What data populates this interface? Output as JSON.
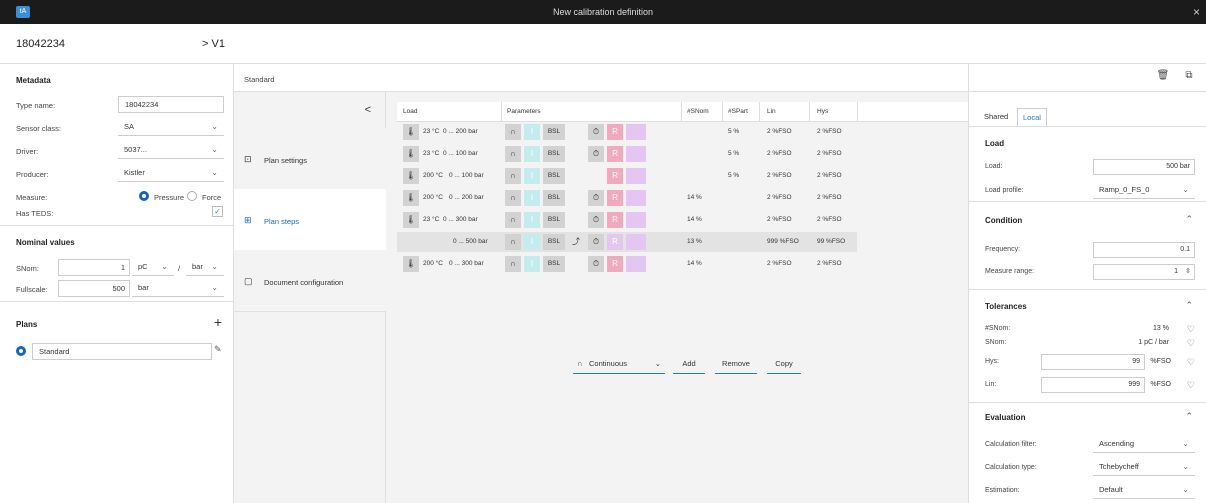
{
  "window": {
    "title": "New calibration definition",
    "close": "×",
    "logo": "tA"
  },
  "header": {
    "serial": "18042234",
    "version": "> V1"
  },
  "metadata": {
    "title": "Metadata",
    "type_label": "Type name:",
    "type_value": "18042234",
    "class_label": "Sensor class:",
    "class_value": "SA",
    "driver_label": "Driver:",
    "driver_value": "5037...",
    "producer_label": "Producer:",
    "producer_value": "Kistler",
    "measure_label": "Measure:",
    "measure_opt1": "Pressure",
    "measure_opt2": "Force",
    "teds_label": "Has TEDS:"
  },
  "nominal": {
    "title": "Nominal values",
    "snom_label": "SNom:",
    "snom_value": "1",
    "unit1": "pC",
    "slash": "/",
    "unit2": "bar",
    "fs_label": "Fullscale:",
    "fs_value": "500",
    "fs_unit": "bar"
  },
  "plans": {
    "title": "Plans",
    "add": "+",
    "item": "Standard"
  },
  "middle": {
    "title": "Standard",
    "collapse": "<"
  },
  "nav": {
    "settings": "Plan settings",
    "steps": "Plan steps",
    "docs": "Document configuration"
  },
  "grid": {
    "headers": {
      "load": "Load",
      "params": "Parameters",
      "snom": "#SNom",
      "spart": "#SPart",
      "lin": "Lin",
      "hys": "Hys"
    },
    "rows": [
      {
        "temp": "23 °C",
        "range": "0 ... 200 bar",
        "snom": "",
        "spart": "5 %",
        "lin": "2 %FSO",
        "hys": "2 %FSO"
      },
      {
        "temp": "23 °C",
        "range": "0 ... 100 bar",
        "snom": "",
        "spart": "5 %",
        "lin": "2 %FSO",
        "hys": "2 %FSO"
      },
      {
        "temp": "200 °C",
        "range": "0 ... 100 bar",
        "snom": "",
        "spart": "5 %",
        "lin": "2 %FSO",
        "hys": "2 %FSO"
      },
      {
        "temp": "200 °C",
        "range": "0 ... 200 bar",
        "snom": "14 %",
        "spart": "",
        "lin": "2 %FSO",
        "hys": "2 %FSO"
      },
      {
        "temp": "23 °C",
        "range": "0 ... 300 bar",
        "snom": "14 %",
        "spart": "",
        "lin": "2 %FSO",
        "hys": "2 %FSO"
      },
      {
        "temp": "",
        "range": "0 ... 500 bar",
        "snom": "13 %",
        "spart": "",
        "lin": "999 %FSO",
        "hys": "99 %FSO"
      },
      {
        "temp": "200 °C",
        "range": "0 ... 300 bar",
        "snom": "14 %",
        "spart": "",
        "lin": "2 %FSO",
        "hys": "2 %FSO"
      }
    ],
    "bsl": "BSL",
    "i": "I",
    "r": "R"
  },
  "actions": {
    "mode": "Continuous",
    "add": "Add",
    "remove": "Remove",
    "copy": "Copy"
  },
  "right": {
    "tab_shared": "Shared",
    "tab_local": "Local",
    "load_title": "Load",
    "load_label": "Load:",
    "load_value": "500 bar",
    "profile_label": "Load profile:",
    "profile_value": "Ramp_0_FS_0",
    "cond_title": "Condition",
    "freq_label": "Frequency:",
    "freq_value": "0.1",
    "range_label": "Measure range:",
    "range_value": "1",
    "tol_title": "Tolerances",
    "t_snom_label": "#SNom:",
    "t_snom_value": "13 %",
    "t_sn_label": "SNom:",
    "t_sn_value": "1 pC / bar",
    "t_hys_label": "Hys:",
    "t_hys_value": "99",
    "t_hys_unit": "%FSO",
    "t_lin_label": "Lin:",
    "t_lin_value": "999",
    "t_lin_unit": "%FSO",
    "eval_title": "Evaluation",
    "filter_label": "Calculation filter:",
    "filter_value": "Ascending",
    "type_label": "Calculation type:",
    "type_value": "Tchebycheff",
    "est_label": "Estimation:",
    "est_value": "Default"
  }
}
